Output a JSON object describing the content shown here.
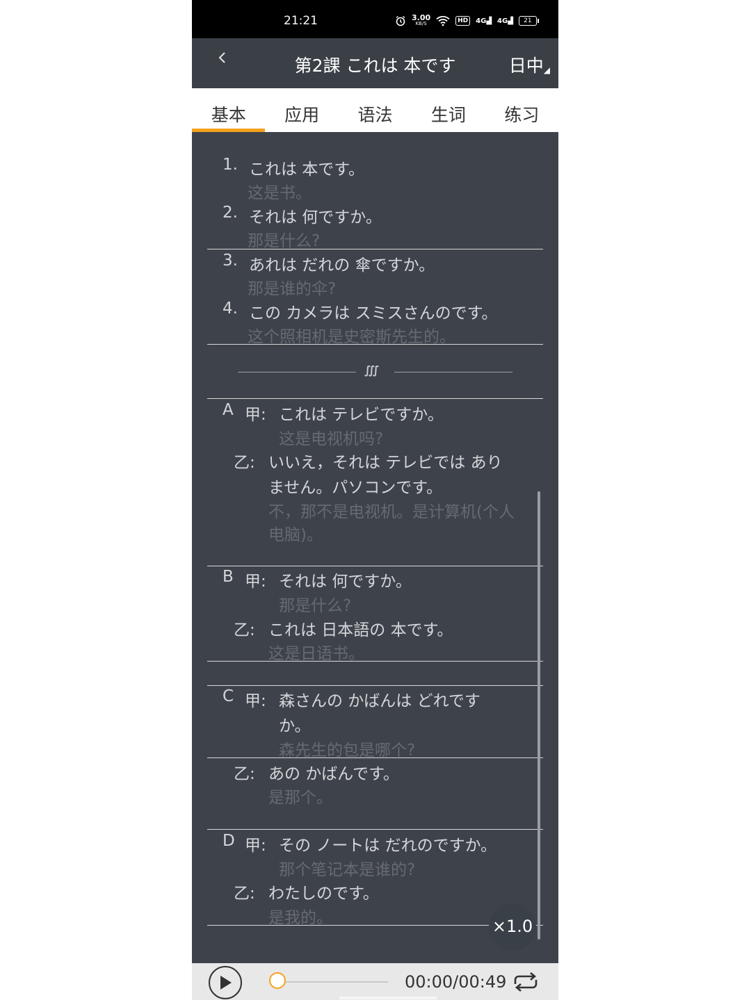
{
  "status_bar": {
    "time": "21:21",
    "net_speed": "3.00",
    "net_unit": "KB/S",
    "hd": "HD",
    "signal1": "4G",
    "signal2": "4G",
    "battery": "21"
  },
  "header": {
    "back_icon": "chevron-left-icon",
    "title": "第2課 これは 本です",
    "lang": "日中"
  },
  "tabs": [
    "基本",
    "应用",
    "语法",
    "生词",
    "练习"
  ],
  "active_tab": "基本",
  "sentences": [
    {
      "num": "1.",
      "jp": "これは 本です。",
      "cn": "这是书。"
    },
    {
      "num": "2.",
      "jp": "それは 何ですか。",
      "cn": "那是什么?"
    },
    {
      "num": "3.",
      "jp": "あれは だれの 傘ですか。",
      "cn": "那是谁的伞?"
    },
    {
      "num": "4.",
      "jp": "この カメラは スミスさんのです。",
      "cn": "这个照相机是史密斯先生的。"
    }
  ],
  "dialogs": {
    "A": {
      "label": "A",
      "jia": "甲:",
      "jia_jp": "これは テレビですか。",
      "jia_cn": "这是电视机吗?",
      "yi": "乙:",
      "yi_jp_1": "いいえ，それは テレビでは あり",
      "yi_jp_2": "ません。パソコンです。",
      "yi_cn_1": "不，那不是电视机。是计算机(个人",
      "yi_cn_2": "电脑)。"
    },
    "B": {
      "label": "B",
      "jia": "甲:",
      "jia_jp": "それは 何ですか。",
      "jia_cn": "那是什么?",
      "yi": "乙:",
      "yi_jp": "これは 日本語の 本です。",
      "yi_cn": "这是日语书。"
    },
    "C": {
      "label": "C",
      "jia": "甲:",
      "jia_jp_1": "森さんの かばんは どれです",
      "jia_jp_2": "か。",
      "jia_cn": "森先生的包是哪个?",
      "yi": "乙:",
      "yi_jp": "あの かばんです。",
      "yi_cn": "是那个。"
    },
    "D": {
      "label": "D",
      "jia": "甲:",
      "jia_jp": "その ノートは だれのですか。",
      "jia_cn": "那个笔记本是谁的?",
      "yi": "乙:",
      "yi_jp": "わたしのです。",
      "yi_cn": "是我的。"
    }
  },
  "speed": "×1.0",
  "player": {
    "time": "00:00/00:49",
    "progress": 0
  },
  "colors": {
    "accent": "#f5a21c",
    "background": "#3e434b"
  }
}
